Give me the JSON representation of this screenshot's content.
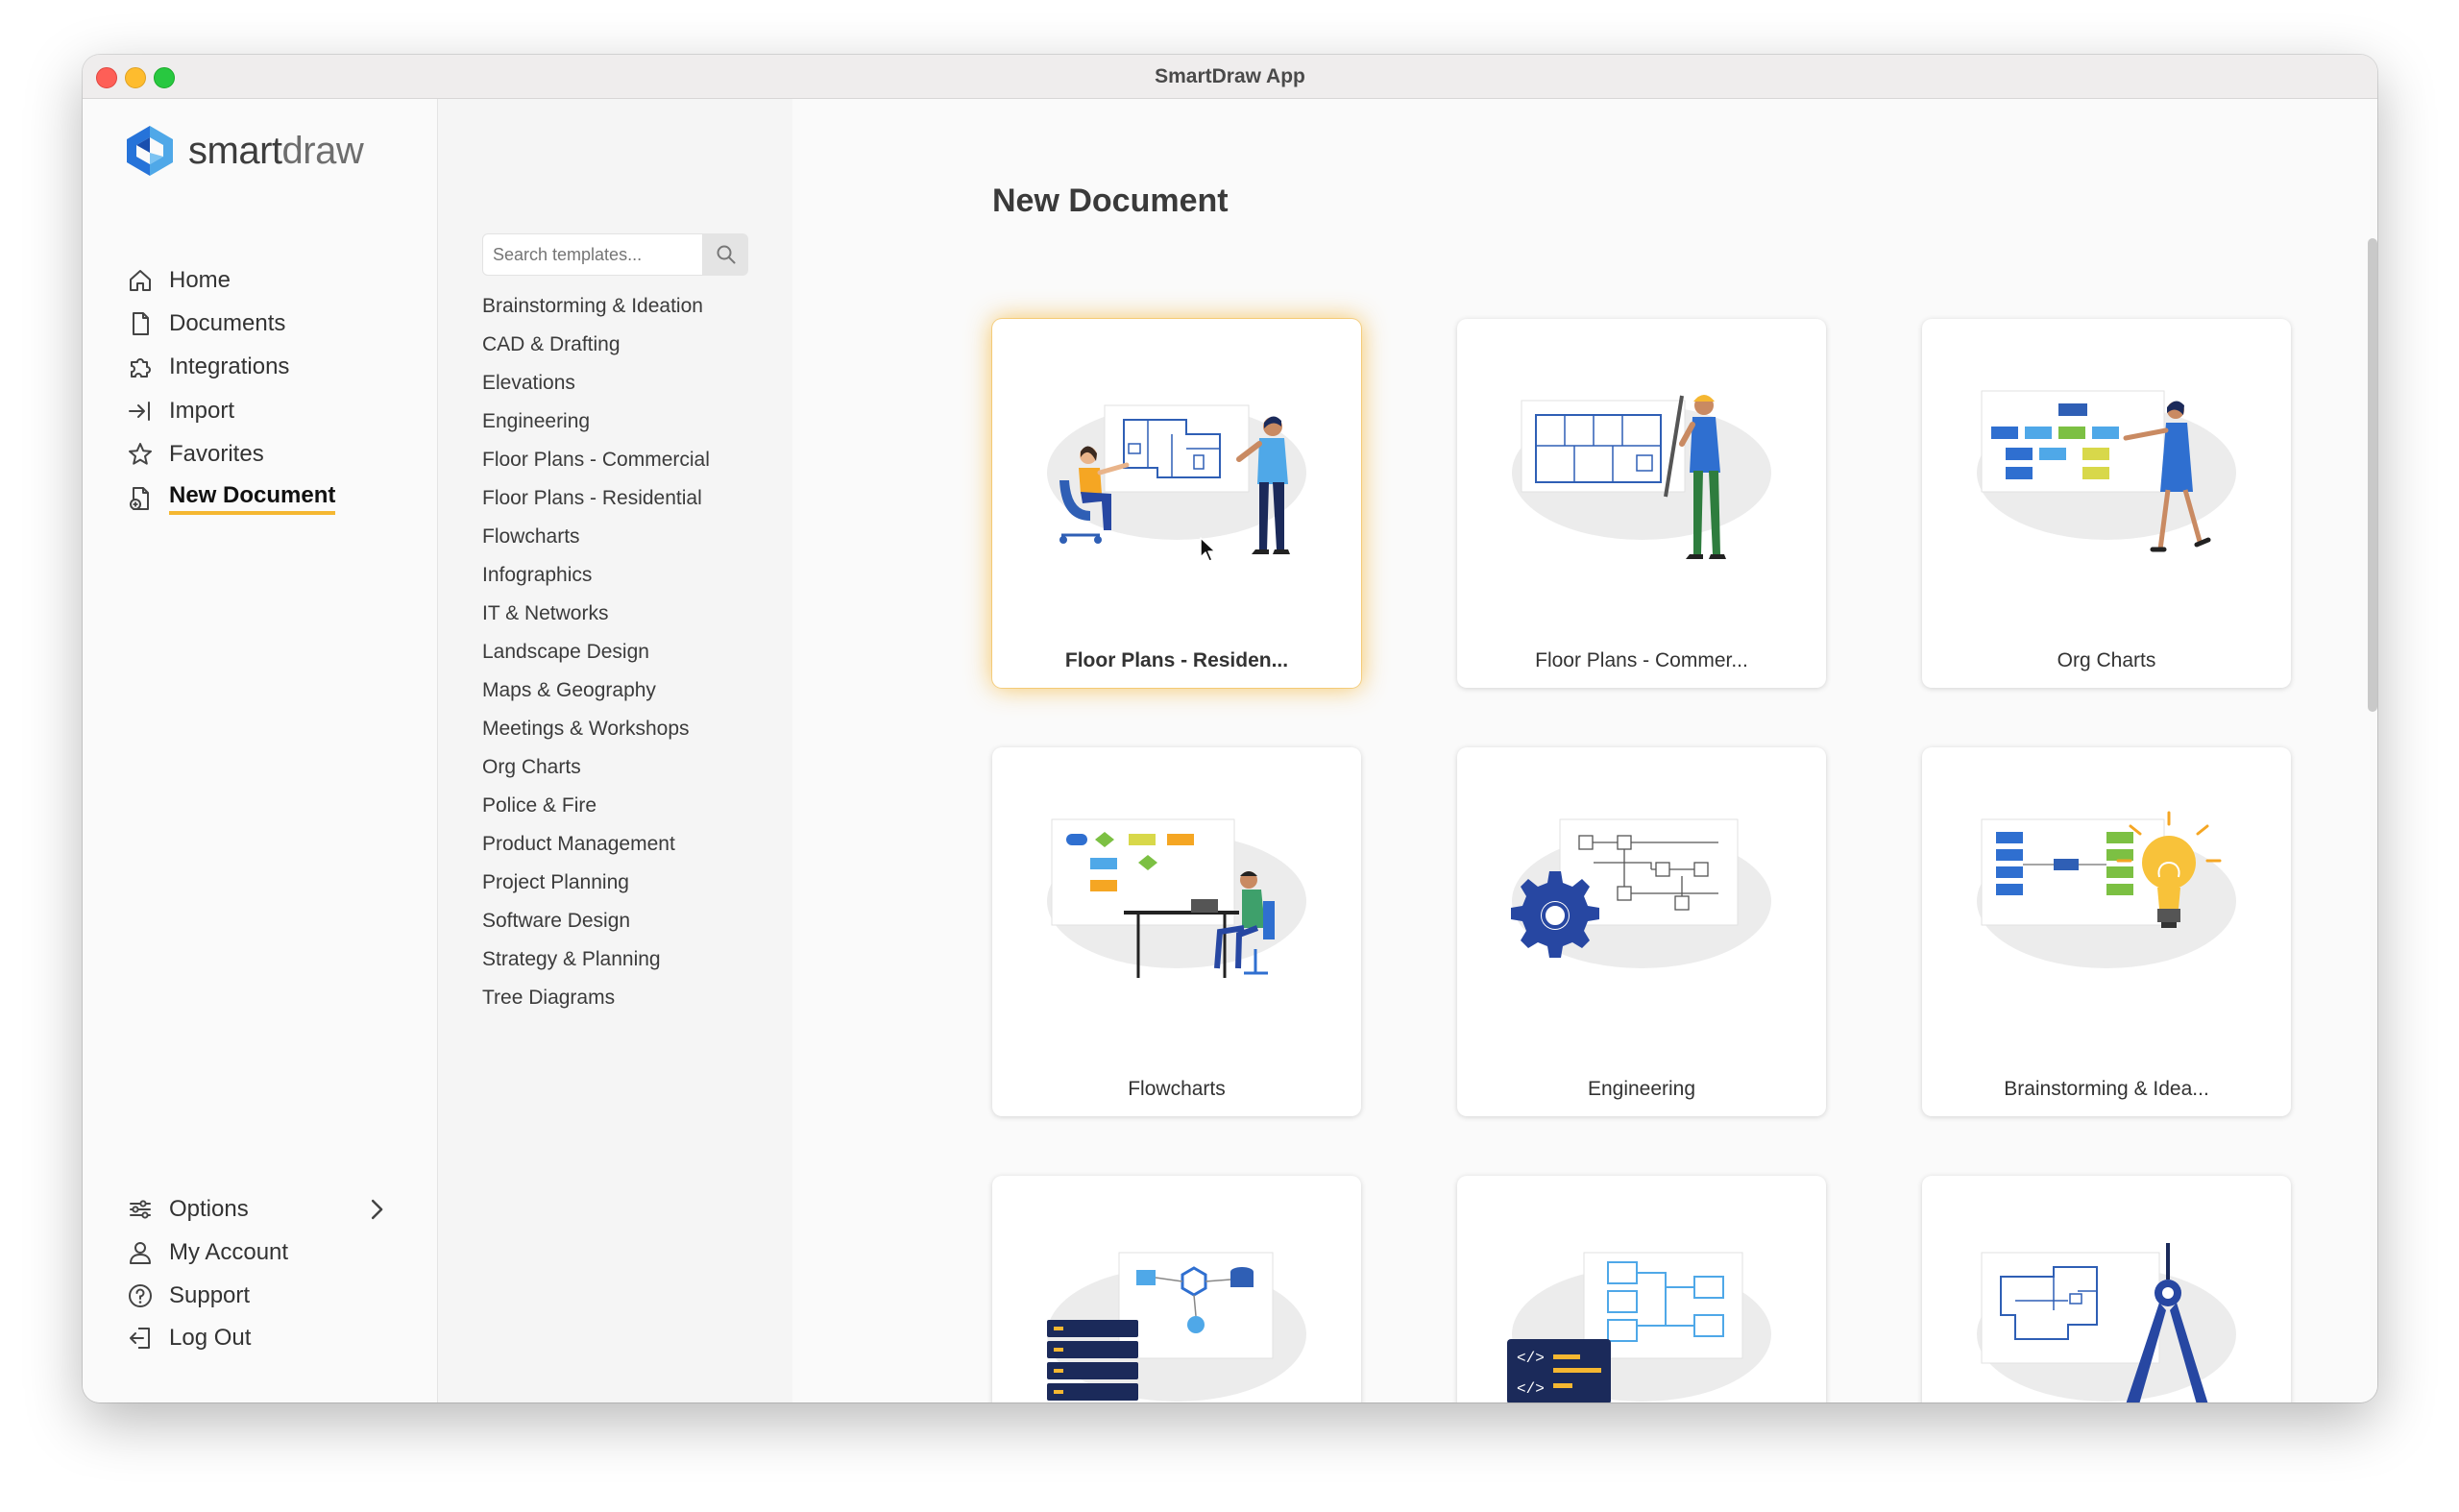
{
  "window": {
    "title": "SmartDraw App"
  },
  "logo": {
    "text_a": "smart",
    "text_b": "draw"
  },
  "nav": {
    "items": [
      {
        "label": "Home",
        "icon": "home-icon"
      },
      {
        "label": "Documents",
        "icon": "document-icon"
      },
      {
        "label": "Integrations",
        "icon": "puzzle-icon"
      },
      {
        "label": "Import",
        "icon": "import-icon"
      },
      {
        "label": "Favorites",
        "icon": "star-icon"
      },
      {
        "label": "New Document",
        "icon": "new-document-icon",
        "active": true
      }
    ],
    "bottom": [
      {
        "label": "Options",
        "icon": "sliders-icon"
      },
      {
        "label": "My Account",
        "icon": "user-icon"
      },
      {
        "label": "Support",
        "icon": "help-icon"
      },
      {
        "label": "Log Out",
        "icon": "logout-icon"
      }
    ]
  },
  "search": {
    "placeholder": "Search templates..."
  },
  "categories": [
    "Brainstorming & Ideation",
    "CAD & Drafting",
    "Elevations",
    "Engineering",
    "Floor Plans - Commercial",
    "Floor Plans - Residential",
    "Flowcharts",
    "Infographics",
    "IT & Networks",
    "Landscape Design",
    "Maps & Geography",
    "Meetings & Workshops",
    "Org Charts",
    "Police & Fire",
    "Product Management",
    "Project Planning",
    "Software Design",
    "Strategy & Planning",
    "Tree Diagrams"
  ],
  "main": {
    "title": "New Document",
    "cards": [
      {
        "label": "Floor Plans - Residen...",
        "selected": true
      },
      {
        "label": "Floor Plans - Commer..."
      },
      {
        "label": "Org Charts"
      },
      {
        "label": "Flowcharts"
      },
      {
        "label": "Engineering"
      },
      {
        "label": "Brainstorming & Idea..."
      },
      {
        "label": ""
      },
      {
        "label": ""
      },
      {
        "label": ""
      }
    ]
  },
  "colors": {
    "accent": "#f5b731",
    "brand_blue": "#1f56b8",
    "light_blue": "#4fa8e8"
  }
}
